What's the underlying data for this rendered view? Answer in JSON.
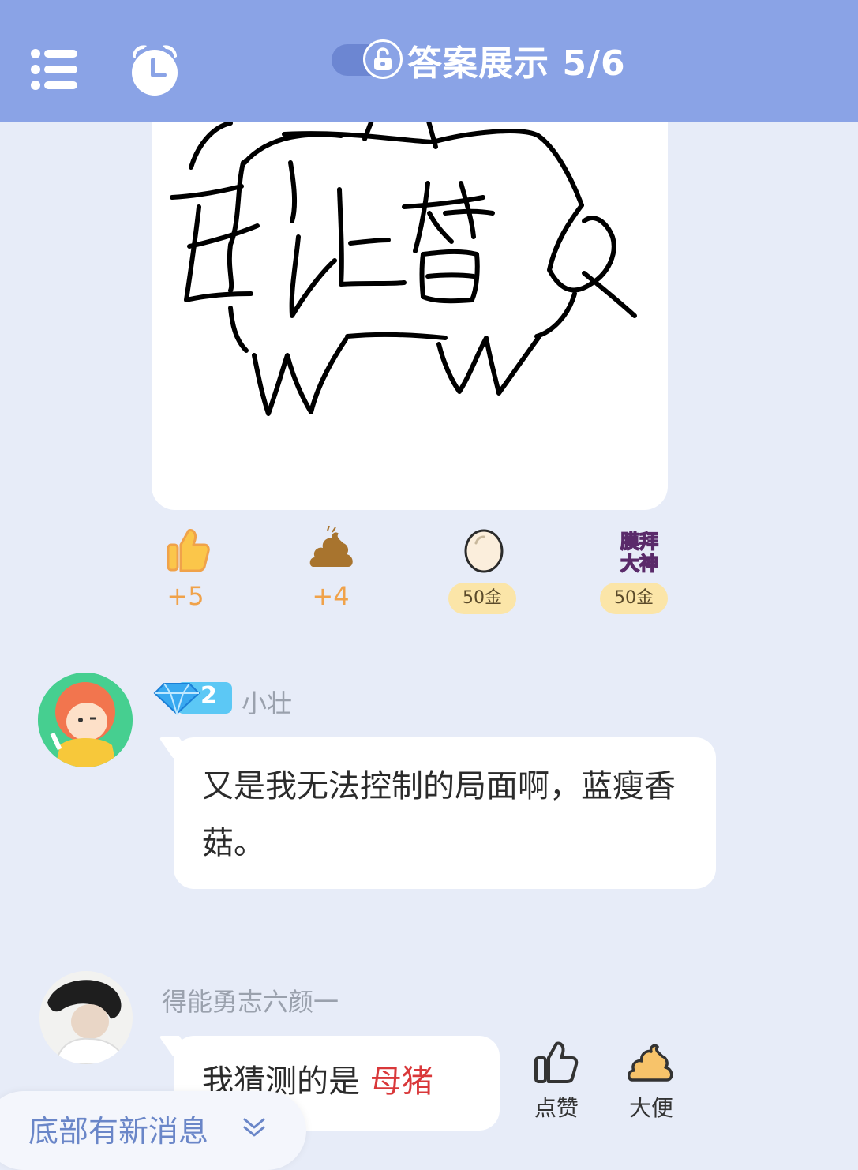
{
  "header": {
    "title": "答案展示 5/6",
    "menu_icon": "list-menu-icon",
    "alarm_icon": "alarm-clock-icon",
    "lock_icon": "unlock-icon"
  },
  "drawing": {
    "text": "让替"
  },
  "reactions": [
    {
      "icon": "thumbs-up-icon",
      "value": "+5"
    },
    {
      "icon": "poop-icon",
      "value": "+4"
    },
    {
      "icon": "egg-icon",
      "value": "50金"
    },
    {
      "icon": "worship-master-sticker",
      "value": "50金",
      "sticker_text": "膜拜大神"
    }
  ],
  "comments": [
    {
      "username": "小壮",
      "level": "2",
      "text": "又是我无法控制的局面啊，蓝瘦香菇。"
    },
    {
      "username": "得能勇志六颜一",
      "text_prefix": "我猜测的是 ",
      "text_highlight": "母猪"
    }
  ],
  "actions": {
    "like_label": "点赞",
    "poop_label": "大便"
  },
  "new_message": {
    "label": "底部有新消息"
  },
  "colors": {
    "header": "#8aa3e6",
    "background": "#e7ecf8",
    "highlight_red": "#d9383a",
    "coin_pill": "#fbe5a8",
    "count_orange": "#f0a24a"
  }
}
